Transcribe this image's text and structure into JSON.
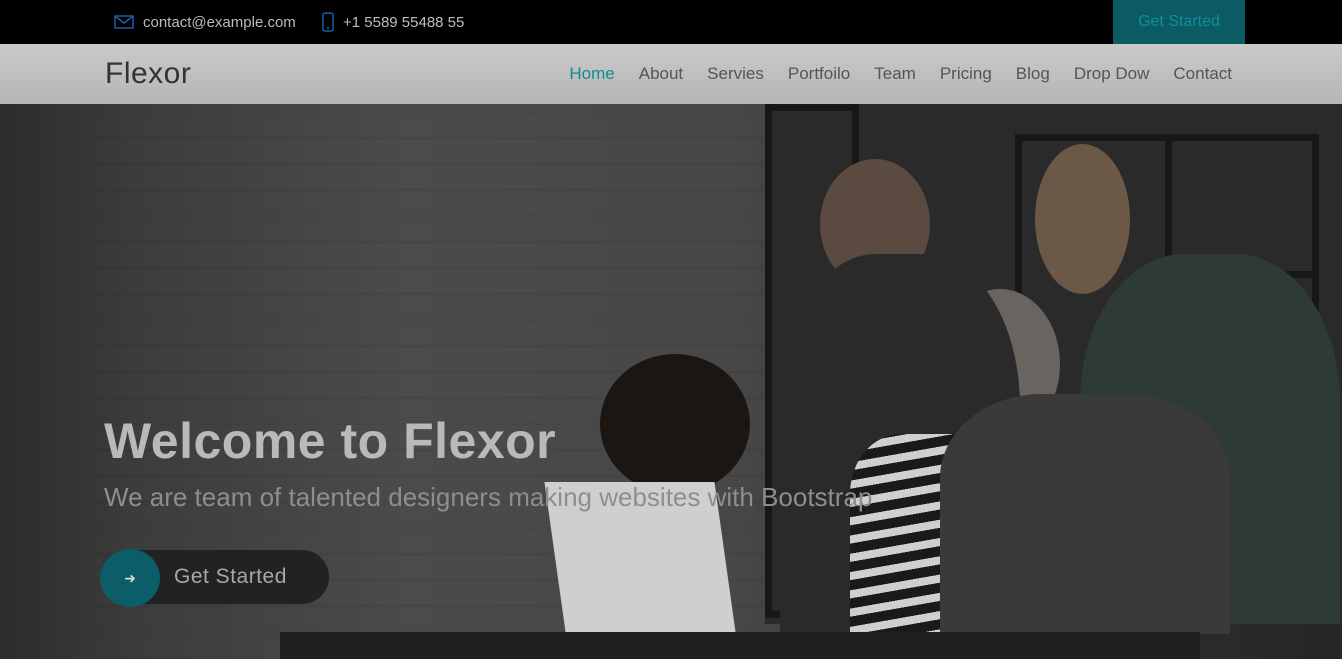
{
  "topbar": {
    "email": "contact@example.com",
    "phone": "+1 5589 55488 55",
    "cta_label": "Get Started",
    "icons": {
      "email": "envelope-icon",
      "phone": "phone-icon"
    }
  },
  "navbar": {
    "logo": "Flexor",
    "items": [
      {
        "label": "Home",
        "active": true
      },
      {
        "label": "About"
      },
      {
        "label": "Servies"
      },
      {
        "label": "Portfoilo"
      },
      {
        "label": "Team"
      },
      {
        "label": "Pricing"
      },
      {
        "label": "Blog"
      },
      {
        "label": "Drop Dow"
      },
      {
        "label": "Contact"
      }
    ]
  },
  "hero": {
    "title": "Welcome to Flexor",
    "subtitle": "We are team of talented designers making websites with Bootstrap",
    "button_label": "Get Started",
    "button_icon": "arrow-right-icon"
  },
  "colors": {
    "accent": "#128b98",
    "accent_dark": "#0c5a63",
    "topbar_bg": "#000000"
  }
}
